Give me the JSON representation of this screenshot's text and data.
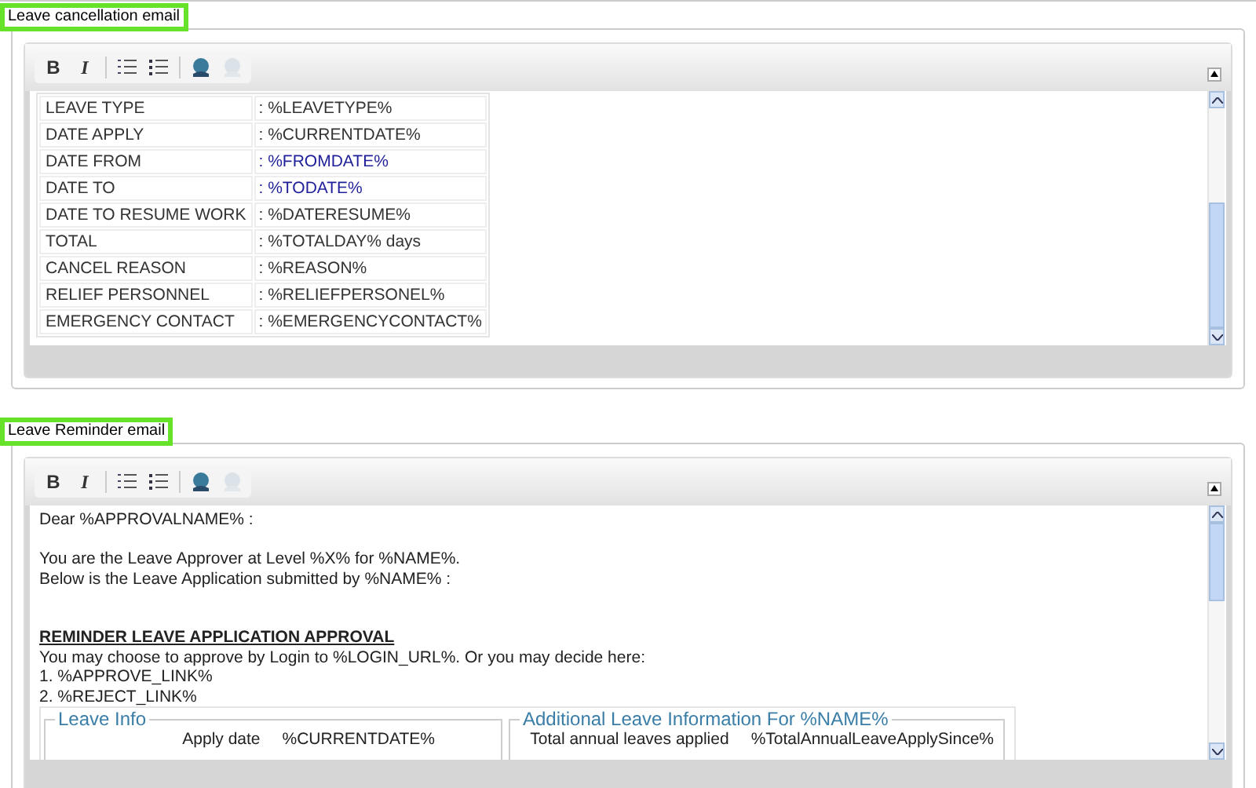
{
  "sections": [
    {
      "title": "Leave cancellation email",
      "toolbar": [
        {
          "kind": "bold",
          "label": "B",
          "disabled": false
        },
        {
          "kind": "italic",
          "label": "I",
          "disabled": false
        },
        {
          "kind": "ordered-list",
          "disabled": false
        },
        {
          "kind": "bullet-list",
          "disabled": false
        },
        {
          "kind": "link",
          "disabled": false
        },
        {
          "kind": "link",
          "disabled": true
        }
      ],
      "content": {
        "kind": "table",
        "rows": [
          {
            "label": "LEAVE TYPE",
            "value": ": %LEAVETYPE%",
            "color": "#333333"
          },
          {
            "label": "DATE APPLY",
            "value": ": %CURRENTDATE%",
            "color": "#333333"
          },
          {
            "label": "DATE FROM",
            "value": ": %FROMDATE%",
            "color": "#1f1f99"
          },
          {
            "label": "DATE TO",
            "value": ": %TODATE%",
            "color": "#1f1f99"
          },
          {
            "label": "DATE TO RESUME WORK",
            "value": ": %DATERESUME%",
            "color": "#333333"
          },
          {
            "label": "TOTAL",
            "value": ": %TOTALDAY% days",
            "color": "#333333"
          },
          {
            "label": "CANCEL REASON",
            "value": ": %REASON%",
            "color": "#333333"
          },
          {
            "label": "RELIEF PERSONNEL",
            "value": ": %RELIEFPERSONEL%",
            "color": "#333333"
          },
          {
            "label": "EMERGENCY CONTACT",
            "value": ": %EMERGENCYCONTACT%",
            "color": "#333333"
          }
        ]
      }
    },
    {
      "title": "Leave Reminder email",
      "toolbar": [
        {
          "kind": "bold",
          "label": "B",
          "disabled": false
        },
        {
          "kind": "italic",
          "label": "I",
          "disabled": false
        },
        {
          "kind": "ordered-list",
          "disabled": false
        },
        {
          "kind": "bullet-list",
          "disabled": false
        },
        {
          "kind": "link",
          "disabled": false
        },
        {
          "kind": "link",
          "disabled": true
        }
      ],
      "content": {
        "kind": "letter",
        "lines": [
          {
            "kind": "text",
            "text": "Dear %APPROVALNAME% :"
          },
          {
            "kind": "gap"
          },
          {
            "kind": "text",
            "text": "You are the Leave Approver at Level %X% for %NAME%."
          },
          {
            "kind": "text",
            "text": "Below is the Leave Application submitted by %NAME% :"
          },
          {
            "kind": "gap"
          },
          {
            "kind": "gap"
          },
          {
            "kind": "heading",
            "text": "REMINDER LEAVE APPLICATION APPROVAL"
          },
          {
            "kind": "text",
            "text": "You may choose to approve by Login to %LOGIN_URL%. Or you may decide here:"
          },
          {
            "kind": "text",
            "text": "1. %APPROVE_LINK%"
          },
          {
            "kind": "text",
            "text": "2. %REJECT_LINK%"
          }
        ],
        "fieldsets": [
          {
            "legend": "Leave Info",
            "label": "Apply date",
            "value": "%CURRENTDATE%"
          },
          {
            "legend": "Additional Leave Information For %NAME%",
            "label": "Total annual leaves applied",
            "value": "%TotalAnnualLeaveApplySince%"
          }
        ]
      }
    }
  ]
}
